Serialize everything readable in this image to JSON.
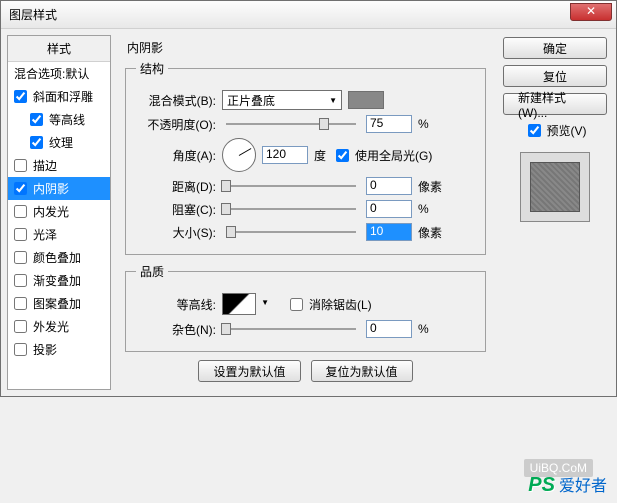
{
  "title": "图层样式",
  "close": "✕",
  "left": {
    "header": "样式",
    "blending": "混合选项:默认",
    "bevel": "斜面和浮雕",
    "contour": "等高线",
    "texture": "纹理",
    "stroke": "描边",
    "innerShadow": "内阴影",
    "innerGlow": "内发光",
    "satin": "光泽",
    "colorOverlay": "颜色叠加",
    "gradOverlay": "渐变叠加",
    "patternOverlay": "图案叠加",
    "outerGlow": "外发光",
    "dropShadow": "投影"
  },
  "mid": {
    "panelTitle": "内阴影",
    "structure": "结构",
    "blendModeLabel": "混合模式(B):",
    "blendModeValue": "正片叠底",
    "opacityLabel": "不透明度(O):",
    "opacityValue": "75",
    "percent": "%",
    "angleLabel": "角度(A):",
    "angleValue": "120",
    "degree": "度",
    "globalLight": "使用全局光(G)",
    "distanceLabel": "距离(D):",
    "distanceValue": "0",
    "px": "像素",
    "chokeLabel": "阻塞(C):",
    "chokeValue": "0",
    "sizeLabel": "大小(S):",
    "sizeValue": "10",
    "quality": "品质",
    "contourLabel": "等高线:",
    "antialias": "消除锯齿(L)",
    "noiseLabel": "杂色(N):",
    "noiseValue": "0",
    "setDefault": "设置为默认值",
    "resetDefault": "复位为默认值"
  },
  "right": {
    "ok": "确定",
    "cancel": "复位",
    "newStyle": "新建样式(W)...",
    "preview": "预览(V)"
  },
  "watermark": {
    "url": "UiBQ.CoM",
    "ps": "PS",
    "txt": "爱好者"
  }
}
